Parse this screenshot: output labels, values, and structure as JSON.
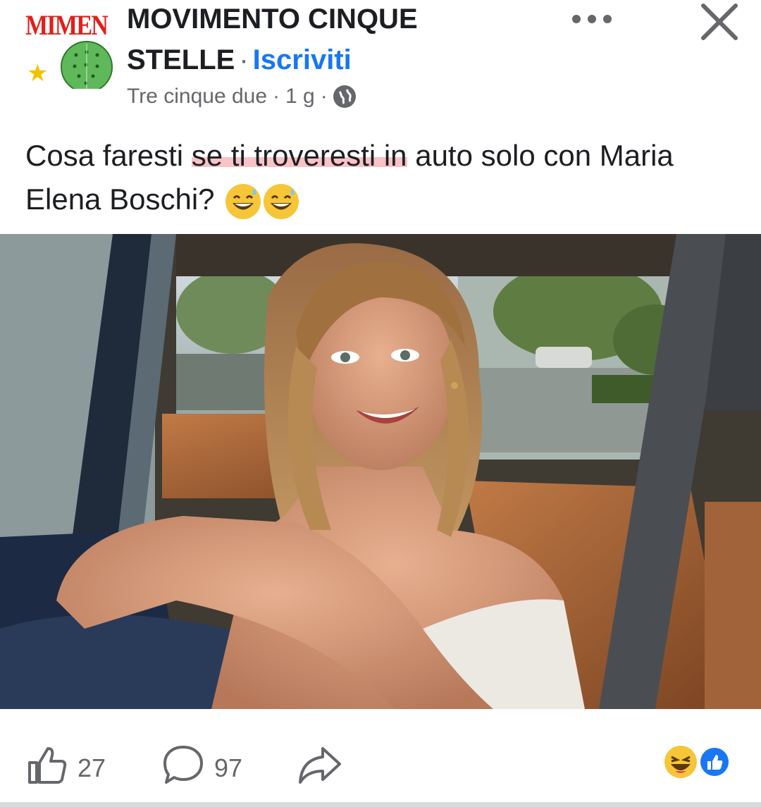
{
  "header": {
    "avatar_text": "MIMEN",
    "group_name_line1": "MOVIMENTO CINQUE",
    "group_name_line2": "STELLE",
    "separator": "·",
    "subscribe_label": "Iscriviti",
    "author": "Tre cinque due",
    "time": "1 g",
    "privacy_icon": "globe-icon",
    "more_icon": "more-horizontal-icon",
    "close_icon": "close-icon"
  },
  "post": {
    "text_before": "Cosa faresti ",
    "text_highlight": "se ti troveresti in",
    "text_after": " auto solo con Maria Elena Boschi?",
    "emoji_count": 2,
    "emoji_name": "grinning-sweat-emoji",
    "highlight_color": "#f07882"
  },
  "footer": {
    "like_icon": "thumbs-up-icon",
    "likes": "27",
    "comment_icon": "comment-bubble-icon",
    "comments": "97",
    "share_icon": "share-arrow-icon",
    "reaction_icons": [
      "laughing-emoji",
      "like-reaction-icon"
    ],
    "accent": "#1877f2"
  }
}
